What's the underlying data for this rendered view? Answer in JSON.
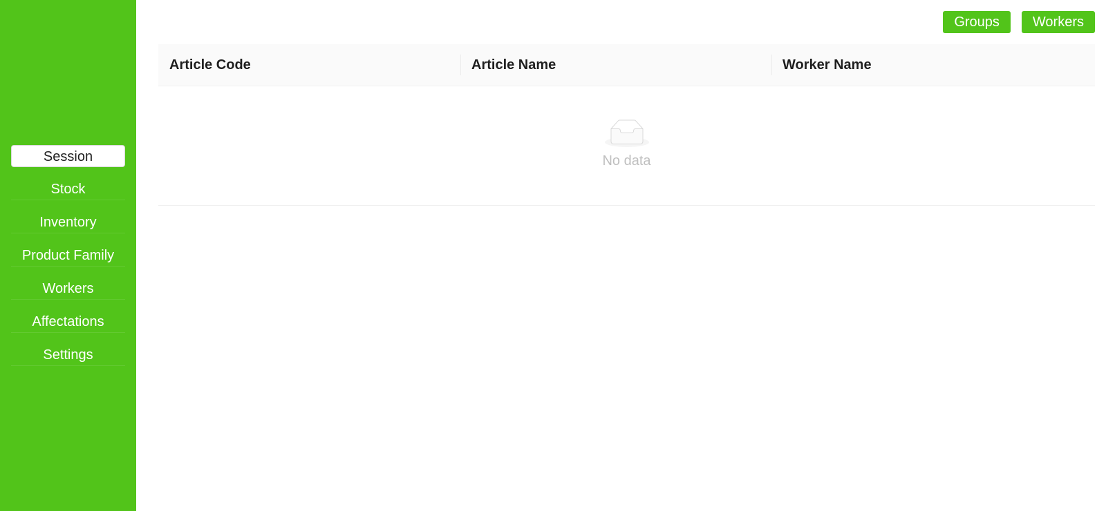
{
  "sidebar": {
    "items": [
      {
        "label": "Session"
      },
      {
        "label": "Stock"
      },
      {
        "label": "Inventory"
      },
      {
        "label": "Product Family"
      },
      {
        "label": "Workers"
      },
      {
        "label": "Affectations"
      },
      {
        "label": "Settings"
      }
    ],
    "active_item": "Session",
    "background_color": "#52c41a"
  },
  "header": {
    "buttons": [
      {
        "label": "Groups"
      },
      {
        "label": "Workers"
      }
    ]
  },
  "table": {
    "columns": [
      {
        "label": "Article Code"
      },
      {
        "label": "Article Name"
      },
      {
        "label": "Worker Name"
      }
    ],
    "rows": [],
    "empty_text": "No data",
    "empty_icon": "inbox-icon"
  },
  "colors": {
    "accent": "#52c41a",
    "empty_text": "#bfbfbf"
  }
}
